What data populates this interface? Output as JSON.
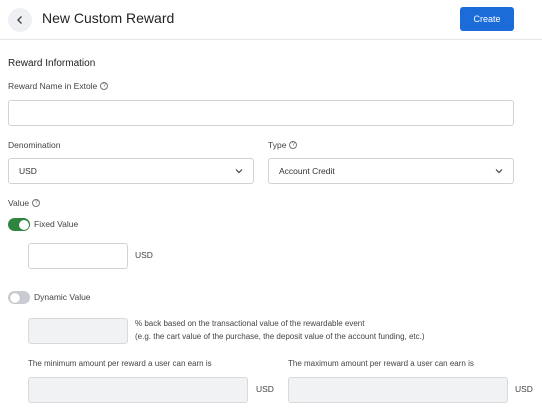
{
  "header": {
    "title": "New Custom Reward",
    "create_label": "Create"
  },
  "section": {
    "title": "Reward Information"
  },
  "reward_name": {
    "label": "Reward Name in Extole",
    "value": "",
    "placeholder": ""
  },
  "denomination": {
    "label": "Denomination",
    "selected": "USD"
  },
  "type": {
    "label": "Type",
    "selected": "Account Credit"
  },
  "value": {
    "label": "Value",
    "fixed": {
      "label": "Fixed Value",
      "enabled": true,
      "amount": "",
      "unit": "USD"
    },
    "dynamic": {
      "label": "Dynamic Value",
      "enabled": false,
      "percent": "",
      "description_line1": "% back based on the transactional value of the rewardable event",
      "description_line2": "(e.g. the cart value of the purchase, the deposit value of the account funding, etc.)",
      "min_label": "The minimum amount per reward a user can earn is",
      "min_unit": "USD",
      "max_label": "The maximum amount per reward a user can earn is",
      "max_unit": "USD"
    }
  },
  "colors": {
    "primary": "#1b6bd9",
    "toggle_on": "#2e8540",
    "toggle_off": "#c9ccd1"
  },
  "icons": {
    "back": "chevron-left-icon",
    "help": "question-circle-icon",
    "dropdown": "chevron-down-icon"
  }
}
